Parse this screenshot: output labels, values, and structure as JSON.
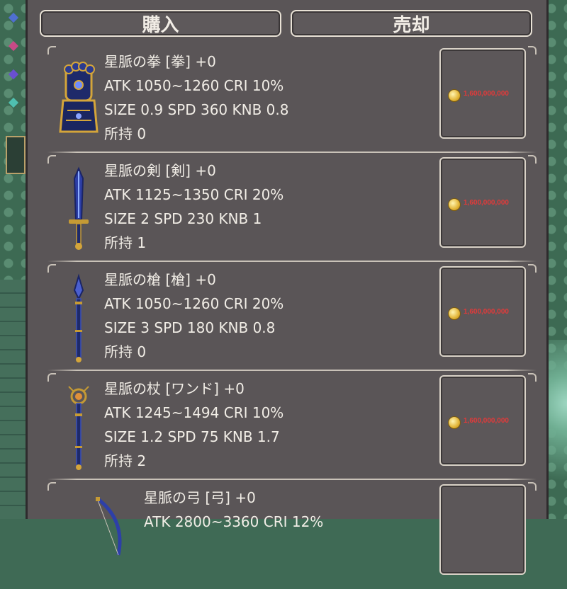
{
  "tabs": {
    "buy": "購入",
    "sell": "売却"
  },
  "colors": {
    "panel": "#5a5557",
    "text": "#f1ede6",
    "price": "#e23a3a",
    "border": "#e9e2d6",
    "background": "#3f6a55"
  },
  "items": [
    {
      "name": "星脈の拳 [拳] +0",
      "stats1": "ATK 1050~1260  CRI 10%",
      "stats2": "SIZE 0.9  SPD 360  KNB 0.8",
      "owned": "所持 0",
      "price": "1,600,000,000",
      "icon": "gauntlet-icon"
    },
    {
      "name": "星脈の剣 [剣] +0",
      "stats1": "ATK 1125~1350  CRI 20%",
      "stats2": "SIZE 2  SPD 230  KNB 1",
      "owned": "所持 1",
      "price": "1,600,000,000",
      "icon": "sword-icon"
    },
    {
      "name": "星脈の槍 [槍] +0",
      "stats1": "ATK 1050~1260  CRI 20%",
      "stats2": "SIZE 3  SPD 180  KNB 0.8",
      "owned": "所持 0",
      "price": "1,600,000,000",
      "icon": "spear-icon"
    },
    {
      "name": "星脈の杖 [ワンド] +0",
      "stats1": "ATK 1245~1494  CRI 10%",
      "stats2": "SIZE 1.2  SPD 75  KNB 1.7",
      "owned": "所持 2",
      "price": "1,600,000,000",
      "icon": "wand-icon"
    },
    {
      "name": "星脈の弓 [弓] +0",
      "stats1": "ATK 2800~3360  CRI 12%",
      "stats2": "",
      "owned": "",
      "price": "",
      "icon": "bow-icon"
    }
  ]
}
